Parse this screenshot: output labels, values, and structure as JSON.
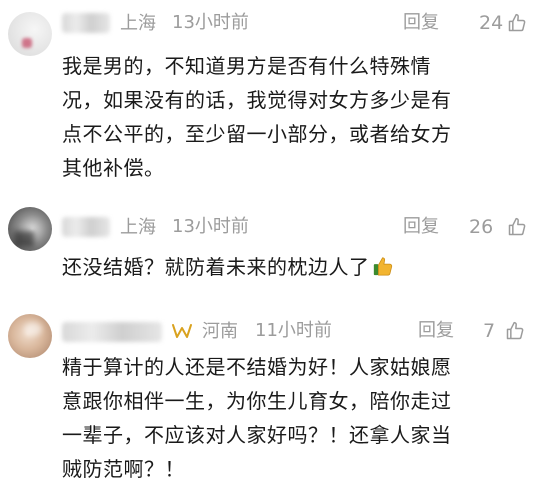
{
  "comments": [
    {
      "location": "上海",
      "time": "13小时前",
      "reply_label": "回复",
      "likes": "24",
      "text_lines": [
        "我是男的，不知道男方是否有什么特殊情",
        "况，如果没有的话，我觉得对女方多少是有",
        "点不公平的，至少留一小部分，或者给女方",
        "其他补偿。"
      ]
    },
    {
      "location": "上海",
      "time": "13小时前",
      "reply_label": "回复",
      "likes": "26",
      "text_lines": [
        "还没结婚？就防着未来的枕边人了"
      ],
      "emoji": "thumbs-up-emoji"
    },
    {
      "location": "河南",
      "time": "11小时前",
      "reply_label": "回复",
      "likes": "7",
      "vip_icon": "vip-badge-icon",
      "text_lines": [
        "精于算计的人还是不结婚为好！人家姑娘愿",
        "意跟你相伴一生，为你生儿育女，陪你走过",
        "一辈子，不应该对人家好吗？！还拿人家当",
        "贼防范啊？！"
      ]
    }
  ],
  "icons": {
    "like": "thumbs-up-outline-icon",
    "emoji": "thumbs-up-emoji"
  },
  "colors": {
    "meta_text": "#9c9c9c",
    "body_text": "#1a1a1a",
    "vip_gold": "#d9a21f"
  }
}
